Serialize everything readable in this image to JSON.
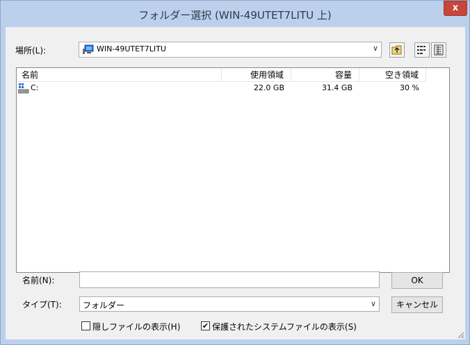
{
  "window": {
    "title": "フォルダー選択 (WIN-49UTET7LITU 上)",
    "close_label": "x"
  },
  "location": {
    "label": "場所(L):",
    "value": "WIN-49UTET7LITU"
  },
  "toolbar": {
    "up_icon": "folder-up-icon",
    "list_icon": "list-view-icon",
    "details_icon": "details-view-icon"
  },
  "table": {
    "columns": [
      "名前",
      "使用領域",
      "容量",
      "空き領域"
    ],
    "rows": [
      {
        "name": "C:",
        "used": "22.0 GB",
        "capacity": "31.4 GB",
        "free": "30 %"
      }
    ]
  },
  "name_field": {
    "label": "名前(N):",
    "value": ""
  },
  "type_field": {
    "label": "タイプ(T):",
    "value": "フォルダー"
  },
  "buttons": {
    "ok": "OK",
    "cancel": "キャンセル"
  },
  "options": {
    "hidden_files": {
      "label": "隠しファイルの表示(H)",
      "checked": false
    },
    "protected_files": {
      "label": "保護されたシステムファイルの表示(S)",
      "checked": true
    }
  },
  "colors": {
    "title_bar": "#bcd0ec",
    "close": "#c7453b",
    "client": "#f0f0f0"
  }
}
